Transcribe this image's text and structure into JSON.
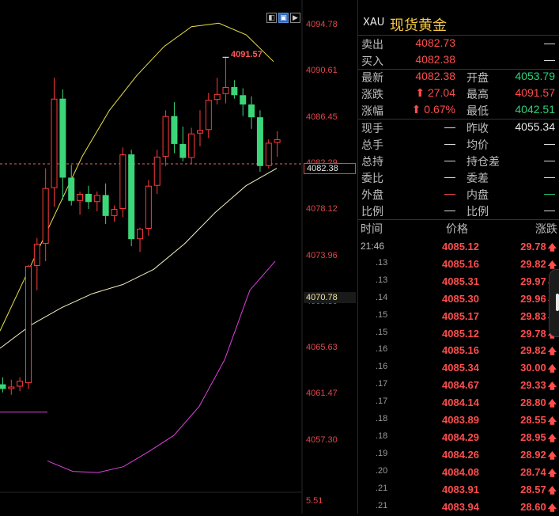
{
  "quote": {
    "symbol": "XAU",
    "name": "现货黄金",
    "rows": [
      {
        "l1": "卖出",
        "v1": "4082.73",
        "c1": "red",
        "l2": "",
        "v2": "—",
        "c2": "white"
      },
      {
        "l1": "买入",
        "v1": "4082.38",
        "c1": "red",
        "l2": "",
        "v2": "—",
        "c2": "white"
      },
      {
        "l1": "最新",
        "v1": "4082.38",
        "c1": "red",
        "l2": "开盘",
        "v2": "4053.79",
        "c2": "green"
      },
      {
        "l1": "涨跌",
        "v1": "⬆ 27.04",
        "c1": "red",
        "l2": "最高",
        "v2": "4091.57",
        "c2": "red"
      },
      {
        "l1": "涨幅",
        "v1": "⬆ 0.67%",
        "c1": "red",
        "l2": "最低",
        "v2": "4042.51",
        "c2": "green"
      },
      {
        "l1": "现手",
        "v1": "—",
        "c1": "white",
        "l2": "昨收",
        "v2": "4055.34",
        "c2": "white"
      },
      {
        "l1": "总手",
        "v1": "—",
        "c1": "white",
        "l2": "均价",
        "v2": "—",
        "c2": "white"
      },
      {
        "l1": "总持",
        "v1": "—",
        "c1": "white",
        "l2": "持仓差",
        "v2": "—",
        "c2": "white"
      },
      {
        "l1": "委比",
        "v1": "—",
        "c1": "white",
        "l2": "委差",
        "v2": "—",
        "c2": "white"
      },
      {
        "l1": "外盘",
        "v1": "—",
        "c1": "red",
        "l2": "内盘",
        "v2": "—",
        "c2": "green"
      },
      {
        "l1": "比例",
        "v1": "—",
        "c1": "white",
        "l2": "比例",
        "v2": "—",
        "c2": "white"
      }
    ]
  },
  "ticks": {
    "headers": {
      "time": "时间",
      "price": "价格",
      "change": "涨跌"
    },
    "up_arrow": "🡅",
    "rows": [
      {
        "time": "21:46",
        "price": "4085.12",
        "chg": "29.78"
      },
      {
        "time": ".13",
        "price": "4085.16",
        "chg": "29.82"
      },
      {
        "time": ".13",
        "price": "4085.31",
        "chg": "29.97"
      },
      {
        "time": ".14",
        "price": "4085.30",
        "chg": "29.96"
      },
      {
        "time": ".15",
        "price": "4085.17",
        "chg": "29.83"
      },
      {
        "time": ".15",
        "price": "4085.12",
        "chg": "29.78"
      },
      {
        "time": ".16",
        "price": "4085.16",
        "chg": "29.82"
      },
      {
        "time": ".16",
        "price": "4085.34",
        "chg": "30.00"
      },
      {
        "time": ".17",
        "price": "4084.67",
        "chg": "29.33"
      },
      {
        "time": ".17",
        "price": "4084.14",
        "chg": "28.80"
      },
      {
        "time": ".18",
        "price": "4083.89",
        "chg": "28.55"
      },
      {
        "time": ".18",
        "price": "4084.29",
        "chg": "28.95"
      },
      {
        "time": ".19",
        "price": "4084.26",
        "chg": "28.92"
      },
      {
        "time": ".20",
        "price": "4084.08",
        "chg": "28.74"
      },
      {
        "time": ".21",
        "price": "4083.91",
        "chg": "28.57"
      },
      {
        "time": ".21",
        "price": "4083.94",
        "chg": "28.60"
      }
    ]
  },
  "chart": {
    "axis_labels": [
      "4094.78",
      "4090.61",
      "4086.45",
      "4082.29",
      "4078.12",
      "4073.96",
      "4069.80",
      "4065.63",
      "4061.47",
      "4057.30"
    ],
    "sub_axis_label": "5.51",
    "current_price_tag": "4082.38",
    "ma_tag": "4070.78",
    "high_marker": "4091.57",
    "controls": [
      "◧",
      "▣",
      "▶"
    ]
  },
  "chart_data": {
    "type": "candlestick",
    "ylim": [
      4055.6,
      4096.5
    ],
    "ohlc": [
      [
        4063.4,
        4064.0,
        4062.7,
        4063.0
      ],
      [
        4063.0,
        4063.8,
        4062.5,
        4063.2
      ],
      [
        4063.2,
        4064.0,
        4062.8,
        4063.7
      ],
      [
        4063.5,
        4073.7,
        4063.0,
        4073.6
      ],
      [
        4073.6,
        4076.0,
        4071.5,
        4075.5
      ],
      [
        4075.5,
        4082.0,
        4074.0,
        4080.3
      ],
      [
        4080.3,
        4089.8,
        4078.7,
        4088.0
      ],
      [
        4088.0,
        4088.8,
        4079.3,
        4081.2
      ],
      [
        4081.2,
        4082.3,
        4078.8,
        4079.2
      ],
      [
        4079.2,
        4080.0,
        4078.0,
        4079.8
      ],
      [
        4079.8,
        4080.5,
        4078.5,
        4079.1
      ],
      [
        4079.1,
        4080.0,
        4078.3,
        4079.7
      ],
      [
        4079.7,
        4080.7,
        4077.2,
        4077.9
      ],
      [
        4077.9,
        4078.8,
        4077.4,
        4078.5
      ],
      [
        4078.5,
        4083.8,
        4077.8,
        4083.2
      ],
      [
        4083.2,
        4083.6,
        4075.3,
        4075.9
      ],
      [
        4075.9,
        4076.9,
        4074.8,
        4076.8
      ],
      [
        4076.8,
        4081.0,
        4076.2,
        4080.5
      ],
      [
        4080.5,
        4083.6,
        4079.8,
        4083.0
      ],
      [
        4083.0,
        4087.0,
        4082.2,
        4086.5
      ],
      [
        4086.5,
        4087.7,
        4083.3,
        4084.1
      ],
      [
        4084.1,
        4085.6,
        4082.6,
        4082.9
      ],
      [
        4082.9,
        4085.5,
        4082.4,
        4085.0
      ],
      [
        4085.0,
        4087.0,
        4083.9,
        4085.3
      ],
      [
        4085.3,
        4088.5,
        4084.6,
        4087.9
      ],
      [
        4087.9,
        4089.8,
        4087.5,
        4088.4
      ],
      [
        4088.4,
        4091.6,
        4087.6,
        4089.0
      ],
      [
        4089.0,
        4089.6,
        4088.0,
        4088.3
      ],
      [
        4088.3,
        4088.9,
        4086.5,
        4087.5
      ],
      [
        4087.5,
        4088.2,
        4085.4,
        4086.4
      ],
      [
        4086.4,
        4087.0,
        4081.7,
        4082.2
      ],
      [
        4082.2,
        4084.5,
        4082.0,
        4084.2
      ],
      [
        4084.2,
        4085.2,
        4083.0,
        4084.5
      ],
      [
        4084.5,
        4085.0,
        4081.5,
        4082.4
      ]
    ],
    "bands": {
      "upper": [
        4068,
        4073,
        4078,
        4083,
        4087,
        4090,
        4092.5,
        4094.2,
        4094.5,
        4093.5,
        4091.2
      ],
      "middle": [
        4066.5,
        4068.5,
        4070.0,
        4071.2,
        4072.0,
        4073.3,
        4075.5,
        4078.2,
        4080.5,
        4082.0
      ],
      "lower": [
        4056.8,
        4055.9,
        4055.8,
        4056.3,
        4057.6,
        4059.0,
        4061.5,
        4065.5,
        4071.5,
        4074.0
      ],
      "lower_tail": [
        4061.0,
        4061.0
      ]
    }
  }
}
